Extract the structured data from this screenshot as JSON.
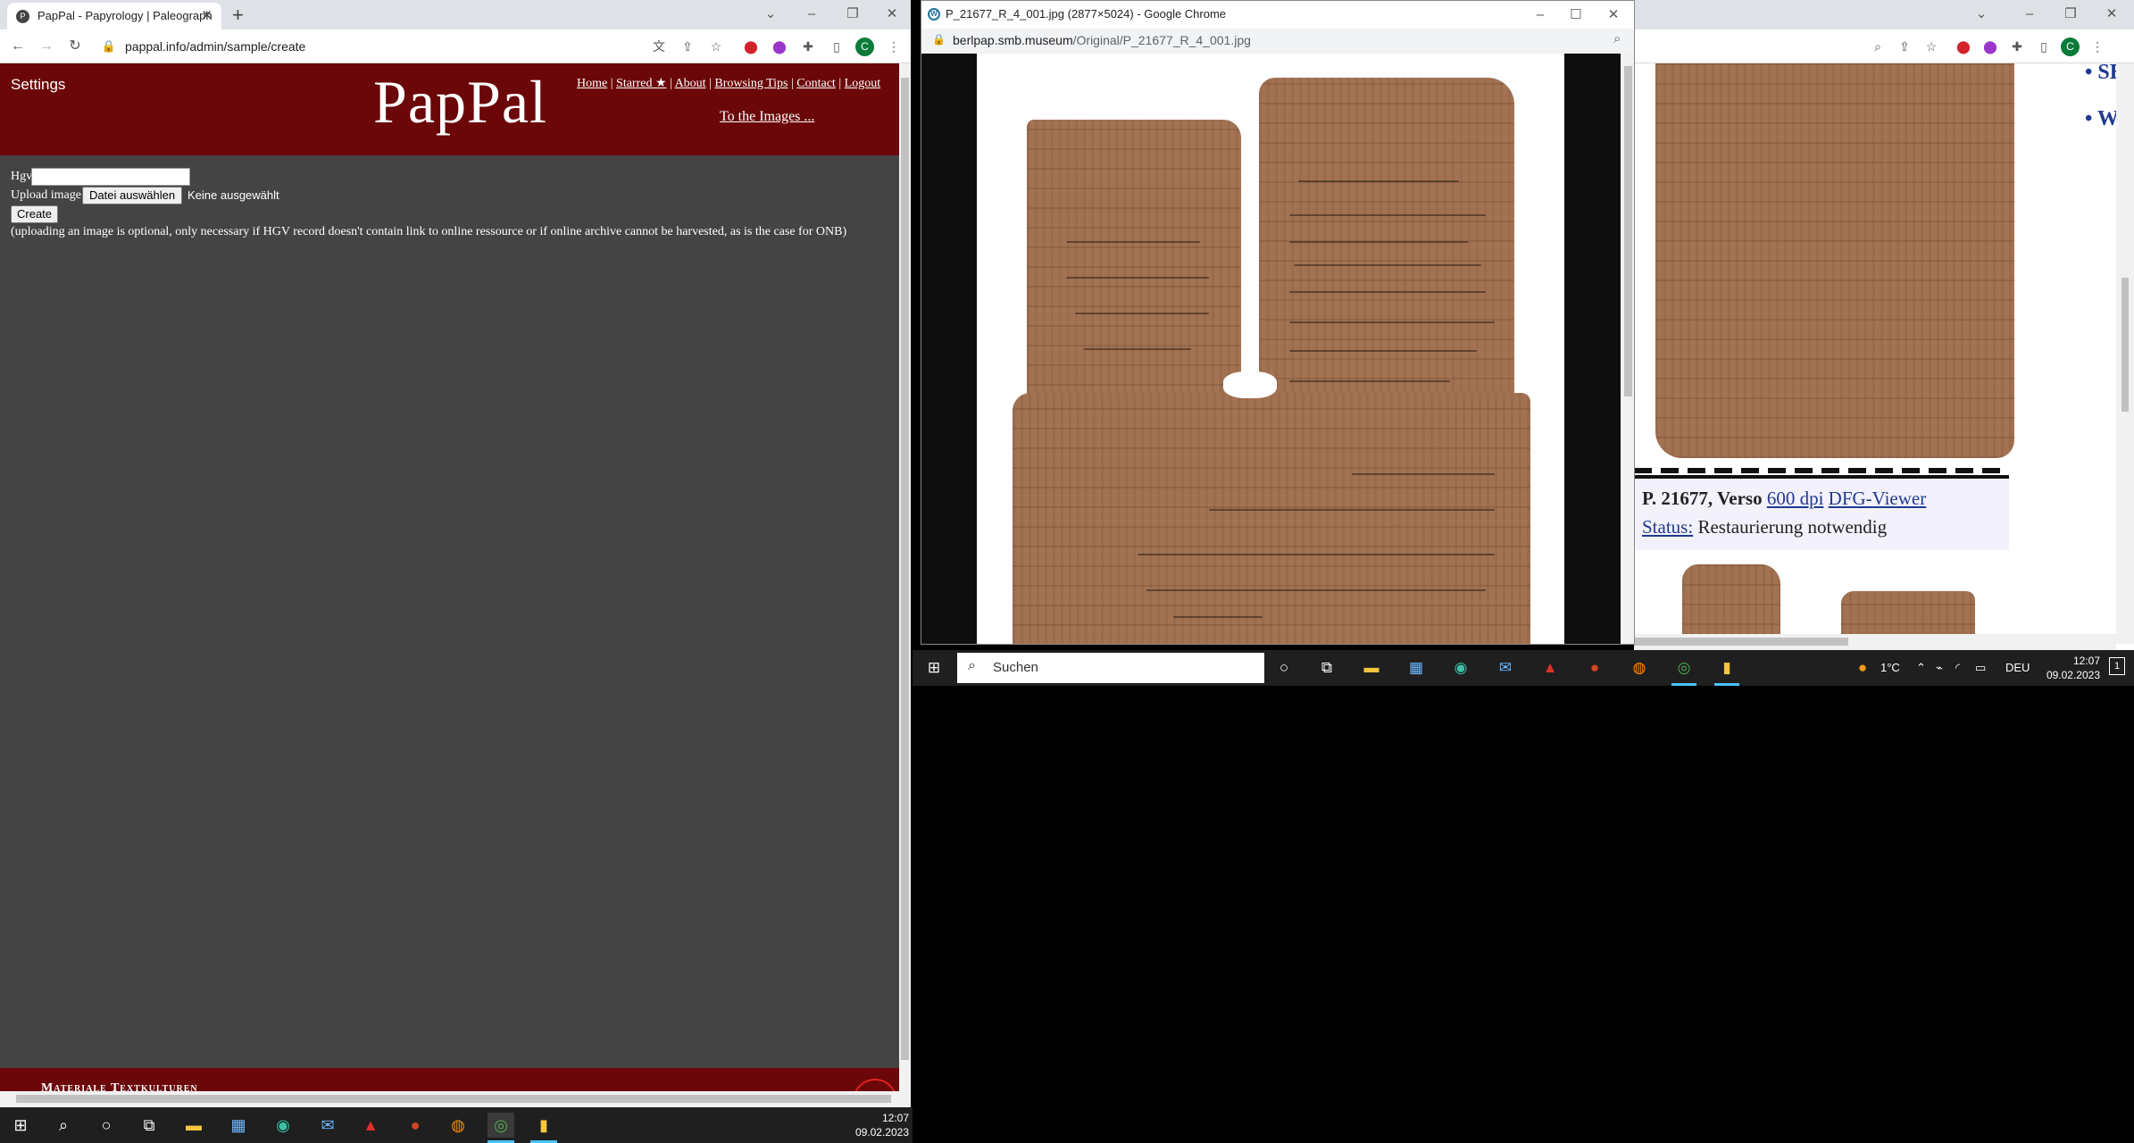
{
  "left_window": {
    "tab_title": "PapPal - Papyrology | Paleograph",
    "favicon": "P",
    "url": "pappal.info/admin/sample/create",
    "profile_initial": "C",
    "header": {
      "settings": "Settings",
      "logo": "PapPal",
      "nav": [
        "Home",
        "Starred ★",
        "About",
        "Browsing Tips",
        "Contact",
        "Logout"
      ],
      "nav_separator": "|",
      "to_images": "To the Images ..."
    },
    "form": {
      "hgv_label": "Hgv",
      "hgv_value": "",
      "upload_label": "Upload image",
      "file_button": "Datei auswählen",
      "no_file": "Keine ausgewählt",
      "create_button": "Create",
      "note": "(uploading an image is optional, only necessary if HGV record doesn't contain link to online ressource or if online archive cannot be harvested, as is the case for ONB)"
    },
    "footer_text": "Materiale Textkulturen"
  },
  "popup_window": {
    "title": "P_21677_R_4_001.jpg (2877×5024) - Google Chrome",
    "url_domain": "berlpap.smb.museum",
    "url_path": "/Original/P_21677_R_4_001.jpg"
  },
  "right_window": {
    "bullets": [
      "SB",
      "We"
    ],
    "caption": {
      "title": "P. 21677, Verso",
      "link_dpi": "600 dpi",
      "link_viewer": "DFG-Viewer",
      "status_label": "Status:",
      "status_value": "Restaurierung notwendig"
    },
    "profile_initial": "C"
  },
  "taskbar_small": {
    "search_placeholder": "Suchen",
    "weather": "1°C",
    "language": "DEU",
    "time": "12:07",
    "date": "09.02.2023",
    "notifications": "1"
  },
  "taskbar_main": {
    "time": "12:07",
    "date": "09.02.2023"
  },
  "colors": {
    "site_header": "#6b0708",
    "page_bg": "#444444",
    "link_blue": "#1f3a8f",
    "papyrus": "#a37252"
  }
}
